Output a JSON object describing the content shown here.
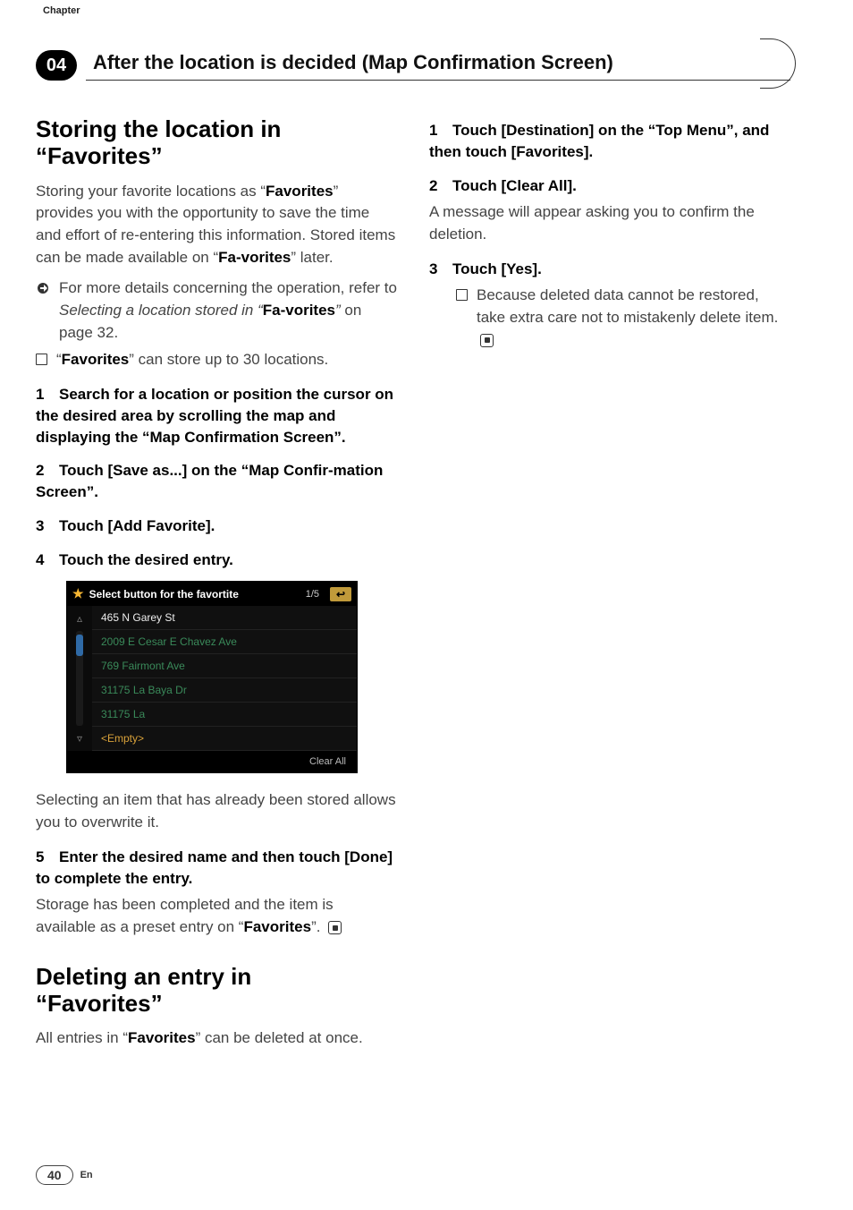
{
  "meta": {
    "chapter_label": "Chapter",
    "chapter_number": "04",
    "chapter_title": "After the location is decided (Map Confirmation Screen)"
  },
  "left": {
    "section1_title_a": "Storing the location in",
    "section1_title_b": "“Favorites”",
    "intro_a": "Storing your favorite locations as “",
    "intro_bold1": "Favorites",
    "intro_b": "” provides you with the opportunity to save the time and effort of re-entering this information. Stored items can be made available on “",
    "intro_bold2": "Fa-vorites",
    "intro_c": "” later.",
    "bullet1_a": "For more details concerning the operation, refer to ",
    "bullet1_i": "Selecting a location stored in “",
    "bullet1_bold": "Fa-vorites",
    "bullet1_i2": "” ",
    "bullet1_c": "on page 32.",
    "bullet2_a": "“",
    "bullet2_bold": "Favorites",
    "bullet2_b": "” can store up to 30 locations.",
    "step1_num": "1",
    "step1": "Search for a location or position the cursor on the desired area by scrolling the map and displaying the “Map Confirmation Screen”.",
    "step2_num": "2",
    "step2": "Touch [Save as...] on the “Map Confir-mation Screen”.",
    "step3_num": "3",
    "step3": "Touch [Add Favorite].",
    "step4_num": "4",
    "step4": "Touch the desired entry.",
    "screenshot": {
      "title": "Select button for the favortite",
      "page": "1/5",
      "rows": [
        "465 N Garey St",
        "2009 E Cesar E Chavez Ave",
        "769 Fairmont Ave",
        "31175 La Baya Dr",
        "31175 La",
        "<Empty>"
      ],
      "footer": "Clear All"
    },
    "after_shot": "Selecting an item that has already been stored allows you to overwrite it.",
    "step5_num": "5",
    "step5": "Enter the desired name and then touch [Done] to complete the entry.",
    "step5_after_a": "Storage has been completed and the item is available as a preset entry on “",
    "step5_after_bold": "Favorites",
    "step5_after_b": "”.",
    "section2_title_a": "Deleting an entry in",
    "section2_title_b": "“Favorites”",
    "sec2_body_a": "All entries in “",
    "sec2_body_bold": "Favorites",
    "sec2_body_b": "” can be deleted at once."
  },
  "right": {
    "step1_num": "1",
    "step1": "Touch [Destination] on the “Top Menu”, and then touch [Favorites].",
    "step2_num": "2",
    "step2": "Touch [Clear All].",
    "step2_after": "A message will appear asking you to confirm the deletion.",
    "step3_num": "3",
    "step3": "Touch [Yes].",
    "step3_bullet": "Because deleted data cannot be restored, take extra care not to mistakenly delete item."
  },
  "footer": {
    "page": "40",
    "lang": "En"
  }
}
